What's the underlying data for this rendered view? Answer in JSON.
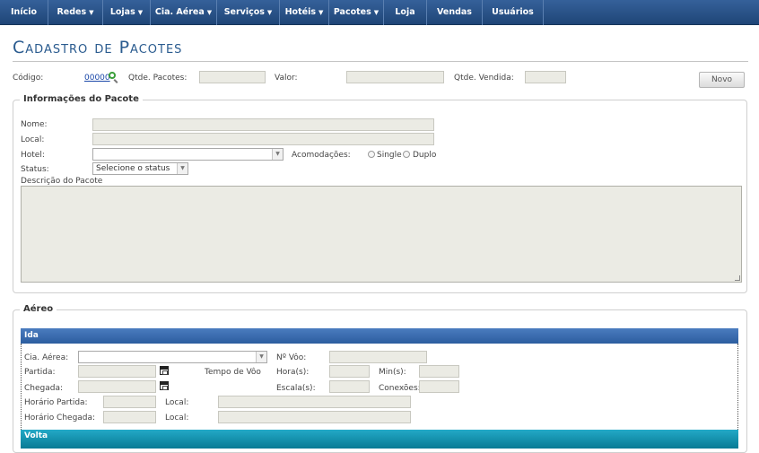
{
  "nav": [
    {
      "label": "Início",
      "dropdown": false
    },
    {
      "label": "Redes",
      "dropdown": true
    },
    {
      "label": "Lojas",
      "dropdown": true
    },
    {
      "label": "Cia. Aérea",
      "dropdown": true
    },
    {
      "label": "Serviços",
      "dropdown": true
    },
    {
      "label": "Hotéis",
      "dropdown": true
    },
    {
      "label": "Pacotes",
      "dropdown": true
    },
    {
      "label": "Loja",
      "dropdown": false
    },
    {
      "label": "Vendas",
      "dropdown": false
    },
    {
      "label": "Usuários",
      "dropdown": false
    }
  ],
  "page": {
    "title": "Cadastro de Pacotes"
  },
  "header_fields": {
    "codigo_label": "Código:",
    "codigo_value": "00000",
    "qtde_pacotes_label": "Qtde. Pacotes:",
    "valor_label": "Valor:",
    "qtde_vendida_label": "Qtde. Vendida:",
    "novo_button": "Novo"
  },
  "info": {
    "legend": "Informações do Pacote",
    "nome_label": "Nome:",
    "local_label": "Local:",
    "hotel_label": "Hotel:",
    "acomodacoes_label": "Acomodações:",
    "single_label": "Single",
    "duplo_label": "Duplo",
    "status_label": "Status:",
    "status_selected": "Selecione o status",
    "descricao_label": "Descrição do Pacote"
  },
  "aereo": {
    "legend": "Aéreo",
    "ida_title": "Ida",
    "volta_title": "Volta",
    "cia_aerea_label": "Cia. Aérea:",
    "n_voo_label": "Nº Vôo:",
    "partida_label": "Partida:",
    "tempo_voo_label": "Tempo de Vôo",
    "horas_label": "Hora(s):",
    "mins_label": "Min(s):",
    "chegada_label": "Chegada:",
    "escalas_label": "Escala(s):",
    "conexoes_label": "Conexões:",
    "horario_partida_label": "Horário Partida:",
    "horario_chegada_label": "Horário Chegada:",
    "local_label": "Local:"
  },
  "colors": {
    "nav_bg": "#2a5288",
    "title": "#2a5b8f",
    "ida_bar": "#3b6db0",
    "volta_bar": "#1590ad",
    "readonly_field": "#ebebe4"
  }
}
